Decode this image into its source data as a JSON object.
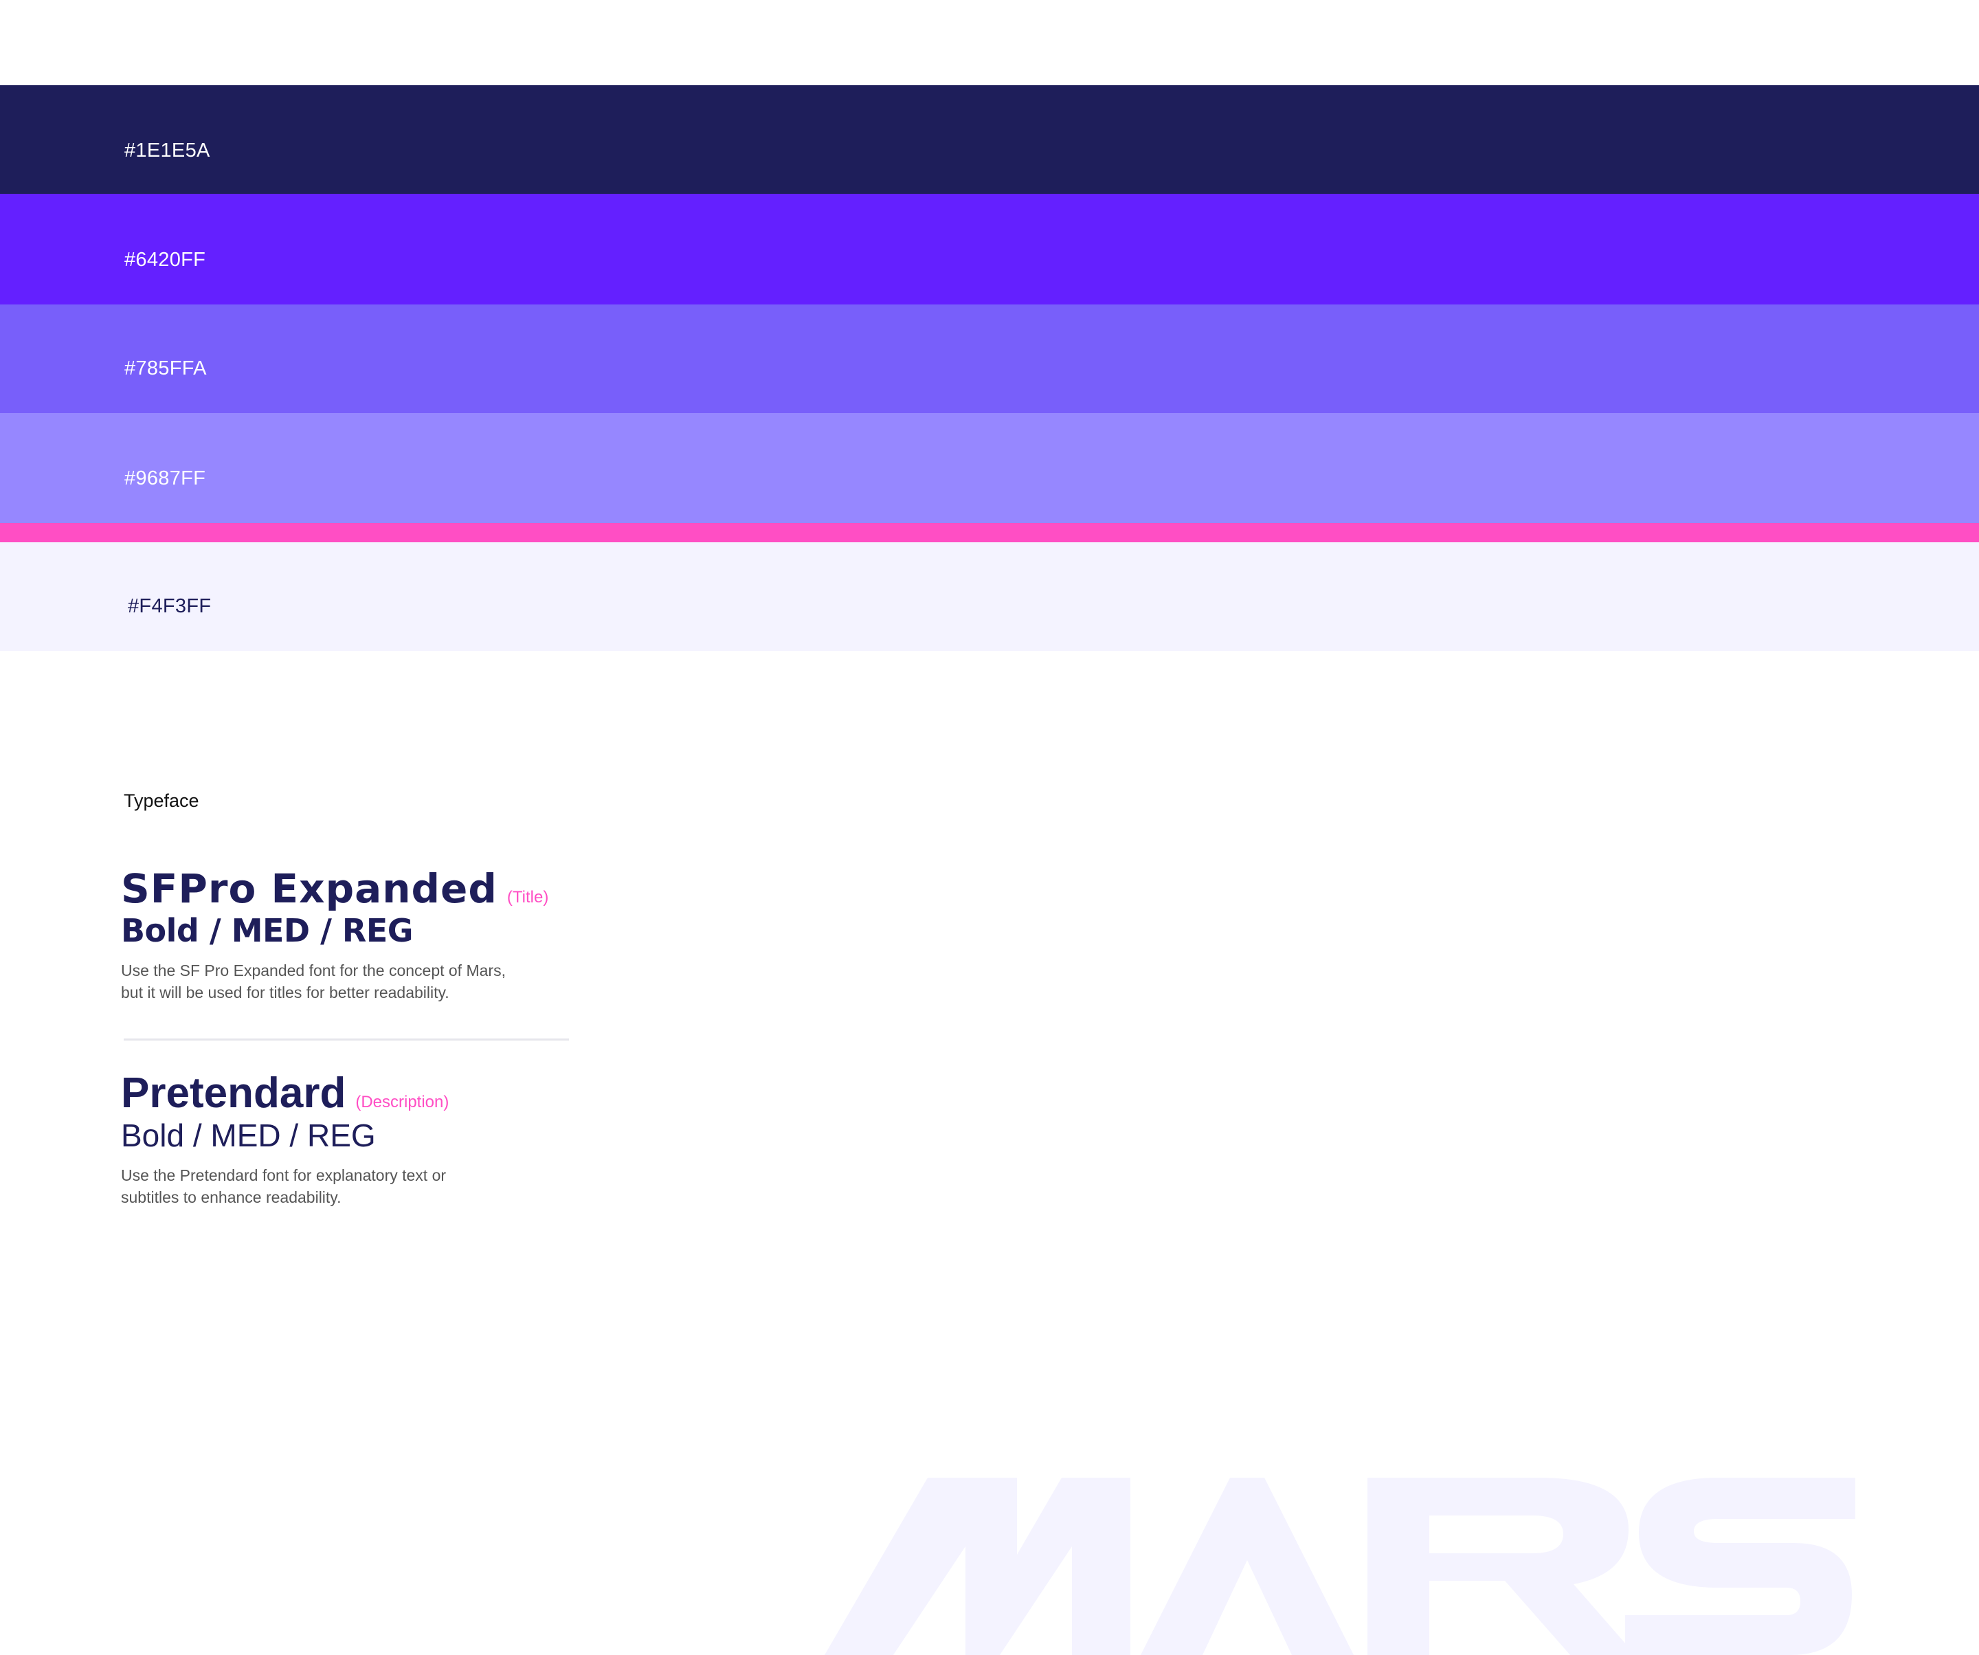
{
  "palette": {
    "swatches": [
      {
        "label": "#1E1E5A",
        "color": "#1E1E5A",
        "text_color": "#FFFFFF"
      },
      {
        "label": "#6420FF",
        "color": "#6420FF",
        "text_color": "#FFFFFF"
      },
      {
        "label": "#785FFA",
        "color": "#785FFA",
        "text_color": "#FFFFFF"
      },
      {
        "label": "#9687FF",
        "color": "#9687FF",
        "text_color": "#FFFFFF"
      },
      {
        "label": "",
        "color": "#FF4EC4",
        "text_color": "#FFFFFF"
      },
      {
        "label": "#F4F3FF",
        "color": "#F4F3FF",
        "text_color": "#1E1E5A"
      }
    ]
  },
  "typeface": {
    "title": "Typeface",
    "fonts": [
      {
        "name": "SFPro Expanded",
        "role": "(Title)",
        "weights": "Bold / MED / REG",
        "description_line1": "Use the SF Pro Expanded font for the concept of Mars,",
        "description_line2": "but it will be used for titles for better readability."
      },
      {
        "name": "Pretendard",
        "role": "(Description)",
        "weights": "Bold / MED / REG",
        "description_line1": "Use the Pretendard font for explanatory text or",
        "description_line2": "subtitles to enhance readability."
      }
    ]
  },
  "colors": {
    "heading": "#1E1E5A",
    "accent": "#FF4EC4",
    "body_text": "#555555",
    "watermark": "#F4F3FF"
  }
}
